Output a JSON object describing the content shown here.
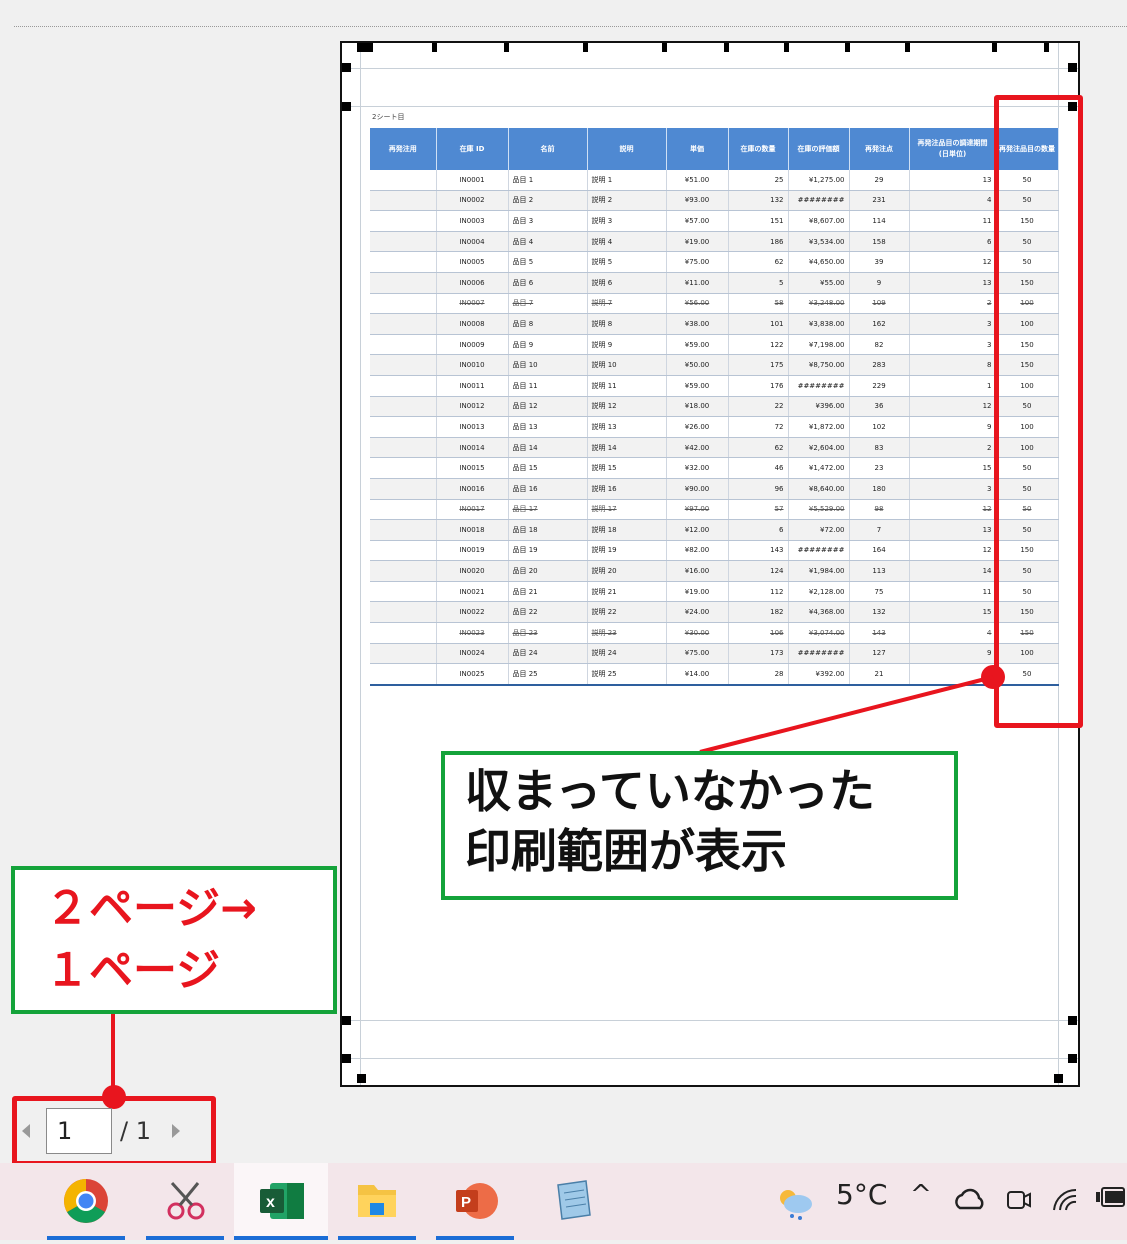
{
  "sheet": {
    "name": "2シート目",
    "headers": [
      "再発注用",
      "在庫 ID",
      "名前",
      "説明",
      "単価",
      "在庫の数量",
      "在庫の評価額",
      "再発注点",
      "再発注品目の調達期間 (日単位)",
      "再発注品目の数量"
    ],
    "rows": [
      {
        "id": "IN0001",
        "name": "品目 1",
        "desc": "説明 1",
        "price": "¥51.00",
        "qty": "25",
        "value": "¥1,275.00",
        "reorder": "29",
        "days": "13",
        "reorder_qty": "50",
        "strike": false
      },
      {
        "id": "IN0002",
        "name": "品目 2",
        "desc": "説明 2",
        "price": "¥93.00",
        "qty": "132",
        "value": "########",
        "reorder": "231",
        "days": "4",
        "reorder_qty": "50",
        "strike": false
      },
      {
        "id": "IN0003",
        "name": "品目 3",
        "desc": "説明 3",
        "price": "¥57.00",
        "qty": "151",
        "value": "¥8,607.00",
        "reorder": "114",
        "days": "11",
        "reorder_qty": "150",
        "strike": false
      },
      {
        "id": "IN0004",
        "name": "品目 4",
        "desc": "説明 4",
        "price": "¥19.00",
        "qty": "186",
        "value": "¥3,534.00",
        "reorder": "158",
        "days": "6",
        "reorder_qty": "50",
        "strike": false
      },
      {
        "id": "IN0005",
        "name": "品目 5",
        "desc": "説明 5",
        "price": "¥75.00",
        "qty": "62",
        "value": "¥4,650.00",
        "reorder": "39",
        "days": "12",
        "reorder_qty": "50",
        "strike": false
      },
      {
        "id": "IN0006",
        "name": "品目 6",
        "desc": "説明 6",
        "price": "¥11.00",
        "qty": "5",
        "value": "¥55.00",
        "reorder": "9",
        "days": "13",
        "reorder_qty": "150",
        "strike": false
      },
      {
        "id": "IN0007",
        "name": "品目 7",
        "desc": "説明 7",
        "price": "¥56.00",
        "qty": "58",
        "value": "¥3,248.00",
        "reorder": "109",
        "days": "2",
        "reorder_qty": "100",
        "strike": true
      },
      {
        "id": "IN0008",
        "name": "品目 8",
        "desc": "説明 8",
        "price": "¥38.00",
        "qty": "101",
        "value": "¥3,838.00",
        "reorder": "162",
        "days": "3",
        "reorder_qty": "100",
        "strike": false
      },
      {
        "id": "IN0009",
        "name": "品目 9",
        "desc": "説明 9",
        "price": "¥59.00",
        "qty": "122",
        "value": "¥7,198.00",
        "reorder": "82",
        "days": "3",
        "reorder_qty": "150",
        "strike": false
      },
      {
        "id": "IN0010",
        "name": "品目 10",
        "desc": "説明 10",
        "price": "¥50.00",
        "qty": "175",
        "value": "¥8,750.00",
        "reorder": "283",
        "days": "8",
        "reorder_qty": "150",
        "strike": false
      },
      {
        "id": "IN0011",
        "name": "品目 11",
        "desc": "説明 11",
        "price": "¥59.00",
        "qty": "176",
        "value": "########",
        "reorder": "229",
        "days": "1",
        "reorder_qty": "100",
        "strike": false
      },
      {
        "id": "IN0012",
        "name": "品目 12",
        "desc": "説明 12",
        "price": "¥18.00",
        "qty": "22",
        "value": "¥396.00",
        "reorder": "36",
        "days": "12",
        "reorder_qty": "50",
        "strike": false
      },
      {
        "id": "IN0013",
        "name": "品目 13",
        "desc": "説明 13",
        "price": "¥26.00",
        "qty": "72",
        "value": "¥1,872.00",
        "reorder": "102",
        "days": "9",
        "reorder_qty": "100",
        "strike": false
      },
      {
        "id": "IN0014",
        "name": "品目 14",
        "desc": "説明 14",
        "price": "¥42.00",
        "qty": "62",
        "value": "¥2,604.00",
        "reorder": "83",
        "days": "2",
        "reorder_qty": "100",
        "strike": false
      },
      {
        "id": "IN0015",
        "name": "品目 15",
        "desc": "説明 15",
        "price": "¥32.00",
        "qty": "46",
        "value": "¥1,472.00",
        "reorder": "23",
        "days": "15",
        "reorder_qty": "50",
        "strike": false
      },
      {
        "id": "IN0016",
        "name": "品目 16",
        "desc": "説明 16",
        "price": "¥90.00",
        "qty": "96",
        "value": "¥8,640.00",
        "reorder": "180",
        "days": "3",
        "reorder_qty": "50",
        "strike": false
      },
      {
        "id": "IN0017",
        "name": "品目 17",
        "desc": "説明 17",
        "price": "¥97.00",
        "qty": "57",
        "value": "¥5,529.00",
        "reorder": "98",
        "days": "12",
        "reorder_qty": "50",
        "strike": true
      },
      {
        "id": "IN0018",
        "name": "品目 18",
        "desc": "説明 18",
        "price": "¥12.00",
        "qty": "6",
        "value": "¥72.00",
        "reorder": "7",
        "days": "13",
        "reorder_qty": "50",
        "strike": false
      },
      {
        "id": "IN0019",
        "name": "品目 19",
        "desc": "説明 19",
        "price": "¥82.00",
        "qty": "143",
        "value": "########",
        "reorder": "164",
        "days": "12",
        "reorder_qty": "150",
        "strike": false
      },
      {
        "id": "IN0020",
        "name": "品目 20",
        "desc": "説明 20",
        "price": "¥16.00",
        "qty": "124",
        "value": "¥1,984.00",
        "reorder": "113",
        "days": "14",
        "reorder_qty": "50",
        "strike": false
      },
      {
        "id": "IN0021",
        "name": "品目 21",
        "desc": "説明 21",
        "price": "¥19.00",
        "qty": "112",
        "value": "¥2,128.00",
        "reorder": "75",
        "days": "11",
        "reorder_qty": "50",
        "strike": false
      },
      {
        "id": "IN0022",
        "name": "品目 22",
        "desc": "説明 22",
        "price": "¥24.00",
        "qty": "182",
        "value": "¥4,368.00",
        "reorder": "132",
        "days": "15",
        "reorder_qty": "150",
        "strike": false
      },
      {
        "id": "IN0023",
        "name": "品目 23",
        "desc": "説明 23",
        "price": "¥30.00",
        "qty": "106",
        "value": "¥3,074.00",
        "reorder": "143",
        "days": "4",
        "reorder_qty": "150",
        "strike": true
      },
      {
        "id": "IN0024",
        "name": "品目 24",
        "desc": "説明 24",
        "price": "¥75.00",
        "qty": "173",
        "value": "########",
        "reorder": "127",
        "days": "9",
        "reorder_qty": "100",
        "strike": false
      },
      {
        "id": "IN0025",
        "name": "品目 25",
        "desc": "説明 25",
        "price": "¥14.00",
        "qty": "28",
        "value": "¥392.00",
        "reorder": "21",
        "days": "8",
        "reorder_qty": "50",
        "strike": false
      }
    ]
  },
  "annotations": {
    "callout_line1": "収まっていなかった",
    "callout_line2": "印刷範囲が表示",
    "pages_line1": "２ページ→",
    "pages_line2": "１ページ"
  },
  "pager": {
    "current": "1",
    "total": "/ 1"
  },
  "taskbar": {
    "apps": [
      "chrome-icon",
      "snipping-tool-icon",
      "excel-icon",
      "file-explorer-icon",
      "powerpoint-icon",
      "notepad-icon"
    ],
    "temperature": "5°C"
  },
  "colors": {
    "header_blue": "#4f89d2",
    "highlight_red": "#e8151e",
    "callout_green": "#14a33a"
  }
}
